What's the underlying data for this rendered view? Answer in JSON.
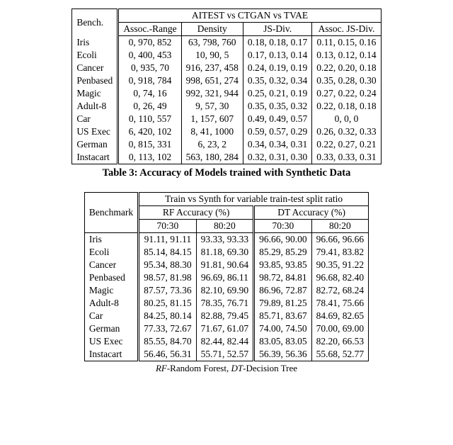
{
  "table1": {
    "header": {
      "bench": "Bench.",
      "super": "AITEST vs CTGAN vs TVAE",
      "cols": [
        "Assoc.-Range",
        "Density",
        "JS-Div.",
        "Assoc. JS-Div."
      ]
    },
    "rows": [
      {
        "name": "Iris",
        "vals": [
          "0, 970, 852",
          "63, 798, 760",
          "0.18, 0.18, 0.17",
          "0.11, 0.15, 0.16"
        ]
      },
      {
        "name": "Ecoli",
        "vals": [
          "0, 400, 453",
          "10, 90, 5",
          "0.17, 0.13, 0.14",
          "0.13, 0.12, 0.14"
        ]
      },
      {
        "name": "Cancer",
        "vals": [
          "0, 935, 70",
          "916, 237, 458",
          "0.24, 0.19, 0.19",
          "0.22, 0.20, 0.18"
        ]
      },
      {
        "name": "Penbased",
        "vals": [
          "0, 918, 784",
          "998, 651, 274",
          "0.35, 0.32, 0.34",
          "0.35, 0.28, 0.30"
        ]
      },
      {
        "name": "Magic",
        "vals": [
          "0, 74, 16",
          "992, 321, 944",
          "0.25, 0.21, 0.19",
          "0.27, 0.22, 0.24"
        ]
      },
      {
        "name": "Adult-8",
        "vals": [
          "0, 26, 49",
          "9, 57, 30",
          "0.35, 0.35, 0.32",
          "0.22, 0.18, 0.18"
        ]
      },
      {
        "name": "Car",
        "vals": [
          "0, 110, 557",
          "1, 157, 607",
          "0.49, 0.49, 0.57",
          "0, 0, 0"
        ]
      },
      {
        "name": "US Exec",
        "vals": [
          "6, 420, 102",
          "8, 41, 1000",
          "0.59, 0.57, 0.29",
          "0.26, 0.32, 0.33"
        ]
      },
      {
        "name": "German",
        "vals": [
          "0, 815, 331",
          "6, 23, 2",
          "0.34, 0.34, 0.31",
          "0.22, 0.27, 0.21"
        ]
      },
      {
        "name": "Instacart",
        "vals": [
          "0, 113, 102",
          "563, 180, 284",
          "0.32, 0.31, 0.30",
          "0.33, 0.33, 0.31"
        ]
      }
    ],
    "caption": "Table 3: Accuracy of Models trained with Synthetic Data"
  },
  "table2": {
    "header": {
      "bench": "Benchmark",
      "super": "Train vs Synth for variable train-test split ratio",
      "groups": [
        "RF Accuracy (%)",
        "DT Accuracy (%)"
      ],
      "splits": [
        "70:30",
        "80:20",
        "70:30",
        "80:20"
      ]
    },
    "rows": [
      {
        "name": "Iris",
        "vals": [
          "91.11, 91.11",
          "93.33, 93.33",
          "96.66, 90.00",
          "96.66, 96.66"
        ]
      },
      {
        "name": "Ecoli",
        "vals": [
          "85.14, 84.15",
          "81.18, 69.30",
          "85.29, 85.29",
          "79.41, 83.82"
        ]
      },
      {
        "name": "Cancer",
        "vals": [
          "95.34, 88.30",
          "91.81, 90.64",
          "93.85, 93.85",
          "90.35, 91.22"
        ]
      },
      {
        "name": "Penbased",
        "vals": [
          "98.57, 81.98",
          "96.69, 86.11",
          "98.72, 84.81",
          "96.68, 82.40"
        ]
      },
      {
        "name": "Magic",
        "vals": [
          "87.57, 73.36",
          "82.10, 69.90",
          "86.96, 72.87",
          "82.72, 68.24"
        ]
      },
      {
        "name": "Adult-8",
        "vals": [
          "80.25, 81.15",
          "78.35, 76.71",
          "79.89, 81.25",
          "78.41, 75.66"
        ]
      },
      {
        "name": "Car",
        "vals": [
          "84.25, 80.14",
          "82.88, 79.45",
          "85.71, 83.67",
          "84.69, 82.65"
        ]
      },
      {
        "name": "German",
        "vals": [
          "77.33, 72.67",
          "71.67, 61.07",
          "74.00, 74.50",
          "70.00, 69.00"
        ]
      },
      {
        "name": "US Exec",
        "vals": [
          "85.55, 84.70",
          "82.44, 82.44",
          "83.05, 83.05",
          "82.20, 66.53"
        ]
      },
      {
        "name": "Instacart",
        "vals": [
          "56.46, 56.31",
          "55.71, 52.57",
          "56.39, 56.36",
          "55.68, 52.77"
        ]
      }
    ],
    "legend_rf": "RF",
    "legend_rf_txt": "-Random Forest, ",
    "legend_dt": "DT",
    "legend_dt_txt": "-Decision Tree"
  },
  "chart_data": [
    {
      "type": "table",
      "title": "AITEST vs CTGAN vs TVAE",
      "columns": [
        "Bench.",
        "Assoc.-Range",
        "Density",
        "JS-Div.",
        "Assoc. JS-Div."
      ],
      "rows": [
        [
          "Iris",
          "0, 970, 852",
          "63, 798, 760",
          "0.18, 0.18, 0.17",
          "0.11, 0.15, 0.16"
        ],
        [
          "Ecoli",
          "0, 400, 453",
          "10, 90, 5",
          "0.17, 0.13, 0.14",
          "0.13, 0.12, 0.14"
        ],
        [
          "Cancer",
          "0, 935, 70",
          "916, 237, 458",
          "0.24, 0.19, 0.19",
          "0.22, 0.20, 0.18"
        ],
        [
          "Penbased",
          "0, 918, 784",
          "998, 651, 274",
          "0.35, 0.32, 0.34",
          "0.35, 0.28, 0.30"
        ],
        [
          "Magic",
          "0, 74, 16",
          "992, 321, 944",
          "0.25, 0.21, 0.19",
          "0.27, 0.22, 0.24"
        ],
        [
          "Adult-8",
          "0, 26, 49",
          "9, 57, 30",
          "0.35, 0.35, 0.32",
          "0.22, 0.18, 0.18"
        ],
        [
          "Car",
          "0, 110, 557",
          "1, 157, 607",
          "0.49, 0.49, 0.57",
          "0, 0, 0"
        ],
        [
          "US Exec",
          "6, 420, 102",
          "8, 41, 1000",
          "0.59, 0.57, 0.29",
          "0.26, 0.32, 0.33"
        ],
        [
          "German",
          "0, 815, 331",
          "6, 23, 2",
          "0.34, 0.34, 0.31",
          "0.22, 0.27, 0.21"
        ],
        [
          "Instacart",
          "0, 113, 102",
          "563, 180, 284",
          "0.32, 0.31, 0.30",
          "0.33, 0.33, 0.31"
        ]
      ]
    },
    {
      "type": "table",
      "title": "Train vs Synth for variable train-test split ratio",
      "columns": [
        "Benchmark",
        "RF Accuracy (%) 70:30",
        "RF Accuracy (%) 80:20",
        "DT Accuracy (%) 70:30",
        "DT Accuracy (%) 80:20"
      ],
      "rows": [
        [
          "Iris",
          "91.11, 91.11",
          "93.33, 93.33",
          "96.66, 90.00",
          "96.66, 96.66"
        ],
        [
          "Ecoli",
          "85.14, 84.15",
          "81.18, 69.30",
          "85.29, 85.29",
          "79.41, 83.82"
        ],
        [
          "Cancer",
          "95.34, 88.30",
          "91.81, 90.64",
          "93.85, 93.85",
          "90.35, 91.22"
        ],
        [
          "Penbased",
          "98.57, 81.98",
          "96.69, 86.11",
          "98.72, 84.81",
          "96.68, 82.40"
        ],
        [
          "Magic",
          "87.57, 73.36",
          "82.10, 69.90",
          "86.96, 72.87",
          "82.72, 68.24"
        ],
        [
          "Adult-8",
          "80.25, 81.15",
          "78.35, 76.71",
          "79.89, 81.25",
          "78.41, 75.66"
        ],
        [
          "Car",
          "84.25, 80.14",
          "82.88, 79.45",
          "85.71, 83.67",
          "84.69, 82.65"
        ],
        [
          "German",
          "77.33, 72.67",
          "71.67, 61.07",
          "74.00, 74.50",
          "70.00, 69.00"
        ],
        [
          "US Exec",
          "85.55, 84.70",
          "82.44, 82.44",
          "83.05, 83.05",
          "82.20, 66.53"
        ],
        [
          "Instacart",
          "56.46, 56.31",
          "55.71, 52.57",
          "56.39, 56.36",
          "55.68, 52.77"
        ]
      ]
    }
  ]
}
